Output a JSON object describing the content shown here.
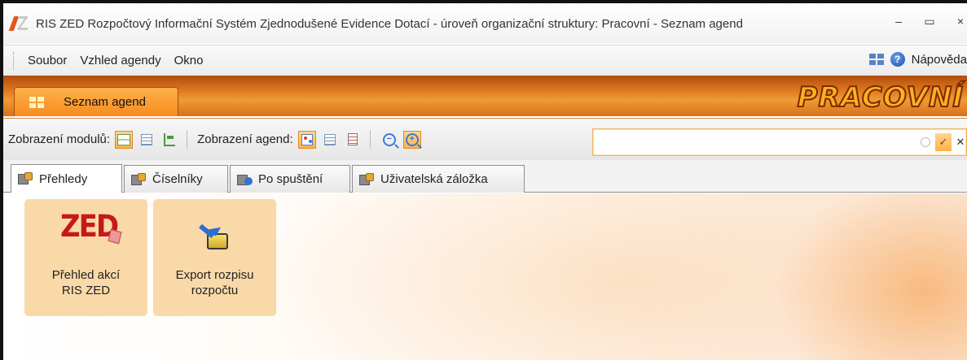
{
  "window": {
    "title": "RIS ZED Rozpočtový Informační Systém Zjednodušené Evidence Dotací - úroveň organizační struktury: Pracovní - Seznam agend",
    "minimize": "–",
    "maximize": "▭",
    "close": "×"
  },
  "menubar": {
    "items": [
      "Soubor",
      "Vzhled agendy",
      "Okno"
    ],
    "help_label": "Nápověda"
  },
  "ribbon": {
    "tab_label": "Seznam agend",
    "brand": "PRACOVNÍ"
  },
  "toolbar": {
    "modules_label": "Zobrazení modulů:",
    "agendas_label": "Zobrazení agend:",
    "search_value": ""
  },
  "content_tabs": [
    {
      "label": "Přehledy",
      "active": true
    },
    {
      "label": "Číselníky",
      "active": false
    },
    {
      "label": "Po spuštění",
      "active": false
    },
    {
      "label": "Uživatelská záložka",
      "active": false
    }
  ],
  "tiles": [
    {
      "label_line1": "Přehled akcí",
      "label_line2": "RIS ZED",
      "logo_text": "ZED"
    },
    {
      "label_line1": "Export rozpisu",
      "label_line2": "rozpočtu"
    }
  ],
  "colors": {
    "accent_orange": "#f68c1f",
    "tile_background": "#fad9a8",
    "brand_text": "#ffb020"
  }
}
